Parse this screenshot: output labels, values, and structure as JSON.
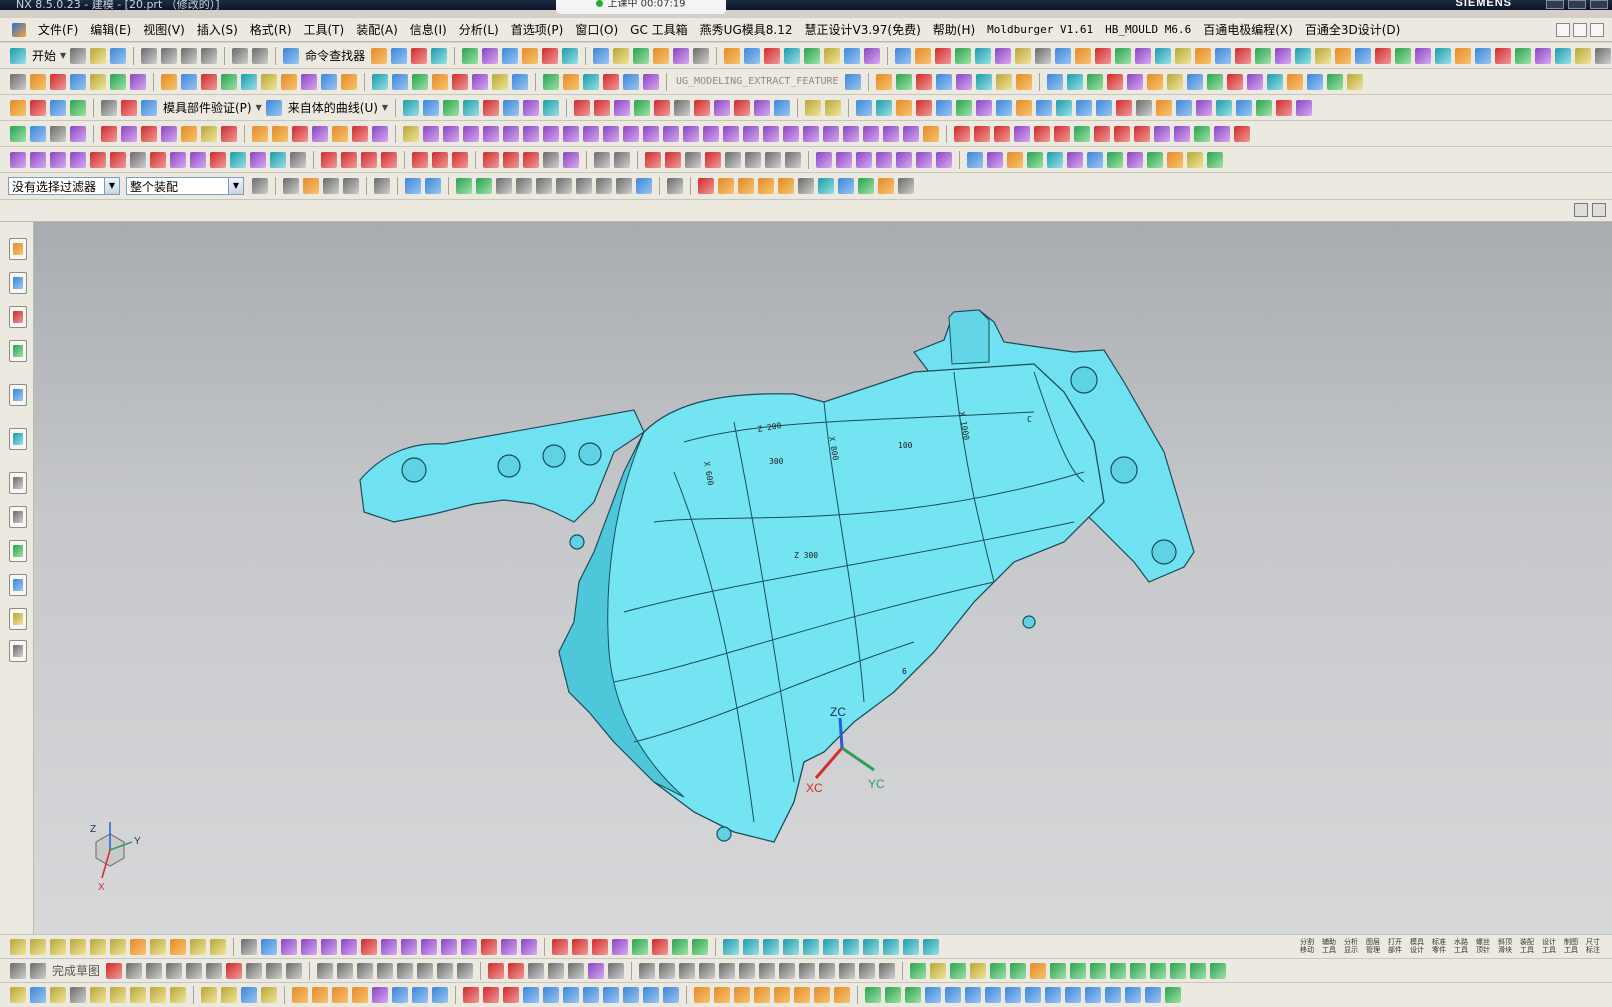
{
  "window": {
    "title": "NX 8.5.0.23 - 建模 - [20.prt （修改的）]",
    "brand": "SIEMENS",
    "recording_label": "上课中 00:07:19"
  },
  "menubar": {
    "items": [
      {
        "label": "文件(F)"
      },
      {
        "label": "编辑(E)"
      },
      {
        "label": "视图(V)"
      },
      {
        "label": "插入(S)"
      },
      {
        "label": "格式(R)"
      },
      {
        "label": "工具(T)"
      },
      {
        "label": "装配(A)"
      },
      {
        "label": "信息(I)"
      },
      {
        "label": "分析(L)"
      },
      {
        "label": "首选项(P)"
      },
      {
        "label": "窗口(O)"
      },
      {
        "label": "GC 工具箱"
      },
      {
        "label": "燕秀UG模具8.12"
      },
      {
        "label": "慧正设计V3.97(免费)"
      },
      {
        "label": "帮助(H)"
      },
      {
        "label": "Moldburger V1.61"
      },
      {
        "label": "HB_MOULD M6.6"
      },
      {
        "label": "百通电极编程(X)"
      },
      {
        "label": "百通全3D设计(D)"
      }
    ]
  },
  "toolbar1": {
    "start_label": "开始",
    "command_finder_label": "命令查找器"
  },
  "toolbar2": {
    "extract_feature_label": "UG_MODELING_EXTRACT_FEATURE"
  },
  "toolbar3": {
    "mold_part_verify_label": "模具部件验证(P)",
    "curve_from_body_label": "来自体的曲线(U)"
  },
  "selectionbar": {
    "filter_value": "没有选择过滤器",
    "scope_value": "整个装配"
  },
  "sketchbar": {
    "finish_sketch_label": "完成草图"
  },
  "bottom_labels": [
    "分割移动",
    "辅助工具",
    "分析显示",
    "图层管理",
    "打开部件",
    "模具设计",
    "标准零件",
    "水路工具",
    "螺丝顶针",
    "斜顶滑块",
    "装配工具",
    "设计工具",
    "制图工具",
    "尺寸标注"
  ],
  "viewport": {
    "wcs": {
      "x": "XC",
      "y": "YC",
      "z": "ZC"
    },
    "triad": {
      "x": "X",
      "y": "Y",
      "z": "Z"
    },
    "dimension_labels": [
      "X 600",
      "Z 200",
      "300",
      "X 800",
      "100",
      "X 1000",
      "C",
      "Z 300",
      "6"
    ]
  },
  "colors": {
    "part_fill": "#6fe1f0",
    "part_edge": "#1b4d5a",
    "wcs_x": "#d62b2b",
    "wcs_y": "#2ca05a",
    "wcs_z": "#2a5bd7"
  }
}
